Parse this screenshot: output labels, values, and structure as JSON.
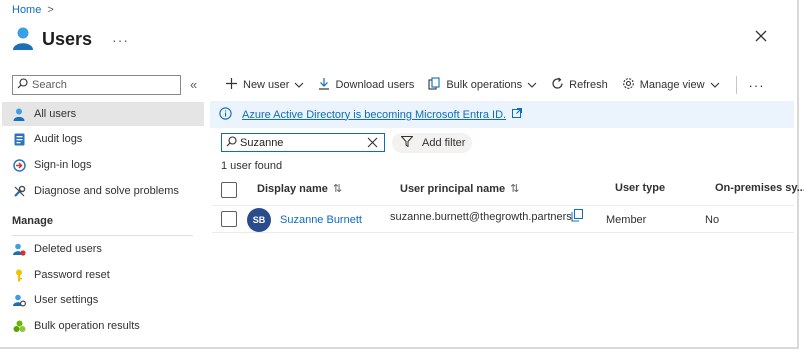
{
  "breadcrumb": {
    "home": "Home",
    "separator": ">"
  },
  "header": {
    "title": "Users",
    "more": "···"
  },
  "sidebar": {
    "search_placeholder": "Search",
    "collapse": "«",
    "items": [
      {
        "label": "All users",
        "icon": "user-icon",
        "active": true
      },
      {
        "label": "Audit logs",
        "icon": "audit-log-icon"
      },
      {
        "label": "Sign-in logs",
        "icon": "sign-in-icon"
      },
      {
        "label": "Diagnose and solve problems",
        "icon": "wrench-icon"
      }
    ],
    "section_title": "Manage",
    "manage_items": [
      {
        "label": "Deleted users",
        "icon": "deleted-users-icon"
      },
      {
        "label": "Password reset",
        "icon": "key-icon"
      },
      {
        "label": "User settings",
        "icon": "user-settings-icon"
      },
      {
        "label": "Bulk operation results",
        "icon": "bulk-results-icon"
      }
    ]
  },
  "toolbar": {
    "new_user": "New user",
    "download_users": "Download users",
    "bulk_operations": "Bulk operations",
    "refresh": "Refresh",
    "manage_view": "Manage view",
    "more": "···"
  },
  "banner": {
    "text": "Azure Active Directory is becoming Microsoft Entra ID."
  },
  "search": {
    "value": "Suzanne",
    "add_filter": "Add filter"
  },
  "results": {
    "count_text": "1 user found"
  },
  "table": {
    "columns": [
      "Display name",
      "User principal name",
      "User type",
      "On-premises sy..."
    ],
    "sort_icon": "⇅",
    "rows": [
      {
        "initials": "SB",
        "display_name": "Suzanne Burnett",
        "upn": "suzanne.burnett@thegrowth.partners",
        "user_type": "Member",
        "on_premises": "No"
      }
    ]
  },
  "colors": {
    "accent": "#0f6cbd",
    "banner_bg": "#ebf3fc",
    "avatar_bg": "#2b4c8c",
    "active_nav": "#e5e5e5"
  }
}
